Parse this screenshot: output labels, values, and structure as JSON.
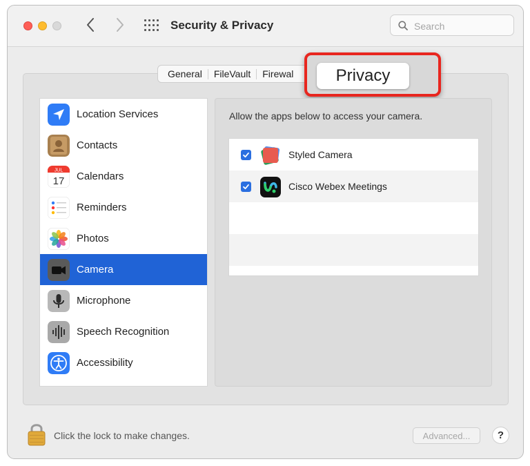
{
  "window": {
    "title": "Security & Privacy"
  },
  "search": {
    "placeholder": "Search"
  },
  "tabs": [
    {
      "label": "General"
    },
    {
      "label": "FileVault"
    },
    {
      "label": "Firewal"
    }
  ],
  "privacy_tab": {
    "label": "Privacy"
  },
  "sidebar": {
    "items": [
      {
        "label": "Location Services",
        "icon": "location-arrow-icon"
      },
      {
        "label": "Contacts",
        "icon": "contacts-icon"
      },
      {
        "label": "Calendars",
        "icon": "calendar-icon",
        "month": "JUL",
        "day": "17"
      },
      {
        "label": "Reminders",
        "icon": "reminders-icon"
      },
      {
        "label": "Photos",
        "icon": "photos-icon"
      },
      {
        "label": "Camera",
        "icon": "camera-icon",
        "selected": true
      },
      {
        "label": "Microphone",
        "icon": "microphone-icon"
      },
      {
        "label": "Speech Recognition",
        "icon": "waveform-icon"
      },
      {
        "label": "Accessibility",
        "icon": "accessibility-icon"
      }
    ]
  },
  "content": {
    "description": "Allow the apps below to access your camera.",
    "apps": [
      {
        "name": "Styled Camera",
        "checked": true
      },
      {
        "name": "Cisco Webex Meetings",
        "checked": true
      }
    ]
  },
  "footer": {
    "lock_text": "Click the lock to make changes.",
    "advanced_label": "Advanced...",
    "help_label": "?"
  },
  "colors": {
    "selection": "#2063d6",
    "callout": "#e8261f",
    "checkbox": "#2b6fe0"
  }
}
